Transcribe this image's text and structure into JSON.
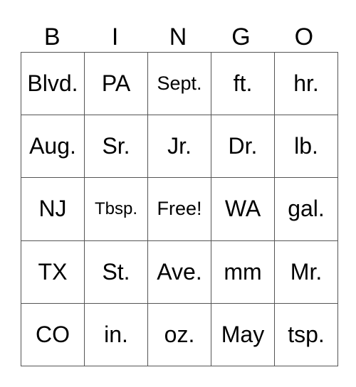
{
  "header": [
    "B",
    "I",
    "N",
    "G",
    "O"
  ],
  "rows": [
    [
      "Blvd.",
      "PA",
      "Sept.",
      "ft.",
      "hr."
    ],
    [
      "Aug.",
      "Sr.",
      "Jr.",
      "Dr.",
      "lb."
    ],
    [
      "NJ",
      "Tbsp.",
      "Free!",
      "WA",
      "gal."
    ],
    [
      "TX",
      "St.",
      "Ave.",
      "mm",
      "Mr."
    ],
    [
      "CO",
      "in.",
      "oz.",
      "May",
      "tsp."
    ]
  ]
}
